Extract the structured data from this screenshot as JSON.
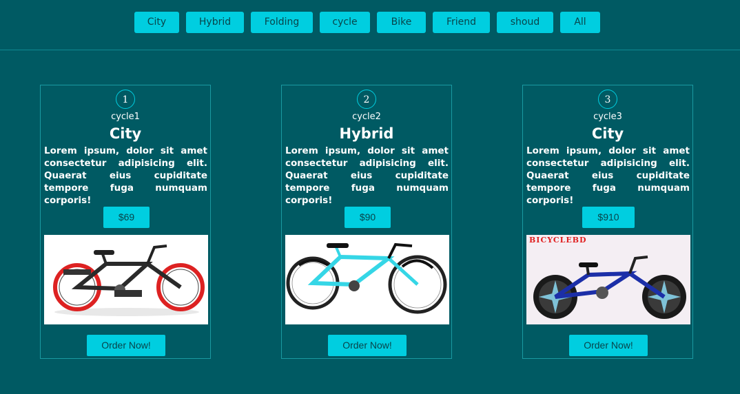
{
  "filters": [
    {
      "label": "City"
    },
    {
      "label": "Hybrid"
    },
    {
      "label": "Folding"
    },
    {
      "label": "cycle"
    },
    {
      "label": "Bike"
    },
    {
      "label": "Friend"
    },
    {
      "label": "shoud"
    },
    {
      "label": "All"
    }
  ],
  "cards": [
    {
      "number": "1",
      "subtitle": "cycle1",
      "title": "City",
      "description": "Lorem ipsum, dolor sit amet consectetur adipisicing elit. Quaerat eius cupiditate tempore fuga numquam corporis!",
      "price": "$69",
      "order_label": "Order Now!",
      "image": "red-black-kids-bicycle-photo"
    },
    {
      "number": "2",
      "subtitle": "cycle2",
      "title": "Hybrid",
      "description": "Lorem ipsum, dolor sit amet consectetur adipisicing elit. Quaerat eius cupiditate tempore fuga numquam corporis!",
      "price": "$90",
      "order_label": "Order Now!",
      "image": "cyan-hybrid-bicycle-photo"
    },
    {
      "number": "3",
      "subtitle": "cycle3",
      "title": "City",
      "description": "Lorem ipsum, dolor sit amet consectetur adipisicing elit. Quaerat eius cupiditate tempore fuga numquam corporis!",
      "price": "$910",
      "order_label": "Order Now!",
      "image": "blue-folding-bicycle-photo",
      "image_brand": "BICYCLEBD"
    }
  ],
  "colors": {
    "background": "#005a63",
    "accent": "#00cee0",
    "card_border": "#1a9aa2",
    "button_text": "#08444a"
  }
}
